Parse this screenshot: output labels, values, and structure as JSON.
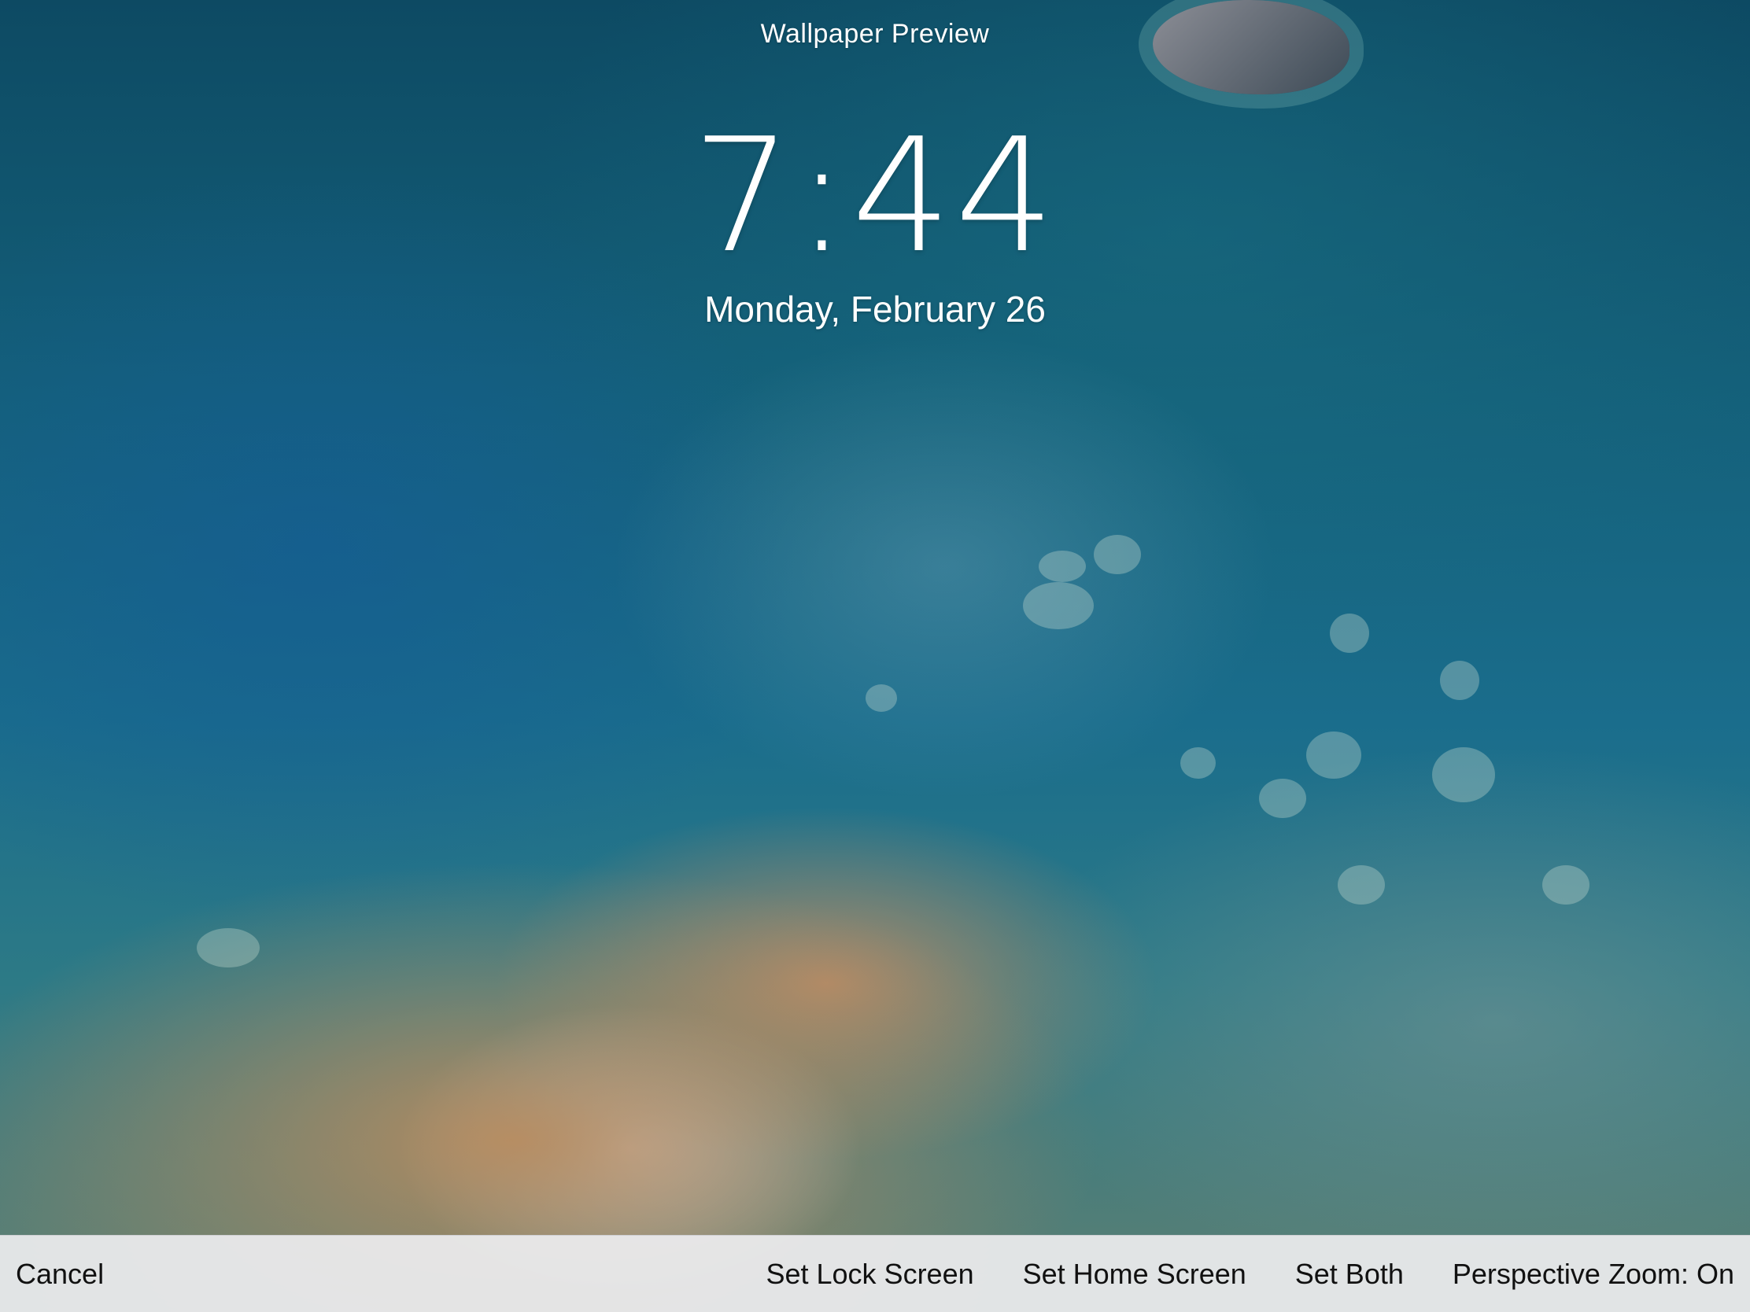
{
  "header": {
    "title": "Wallpaper Preview"
  },
  "lock_screen": {
    "time": "7:44",
    "date": "Monday, February 26"
  },
  "toolbar": {
    "cancel_label": "Cancel",
    "set_lock_label": "Set Lock Screen",
    "set_home_label": "Set Home Screen",
    "set_both_label": "Set Both",
    "perspective_zoom_label": "Perspective Zoom: On"
  },
  "colors": {
    "text": "#ffffff",
    "toolbar_bg": "#ececee",
    "toolbar_text": "#111111"
  }
}
